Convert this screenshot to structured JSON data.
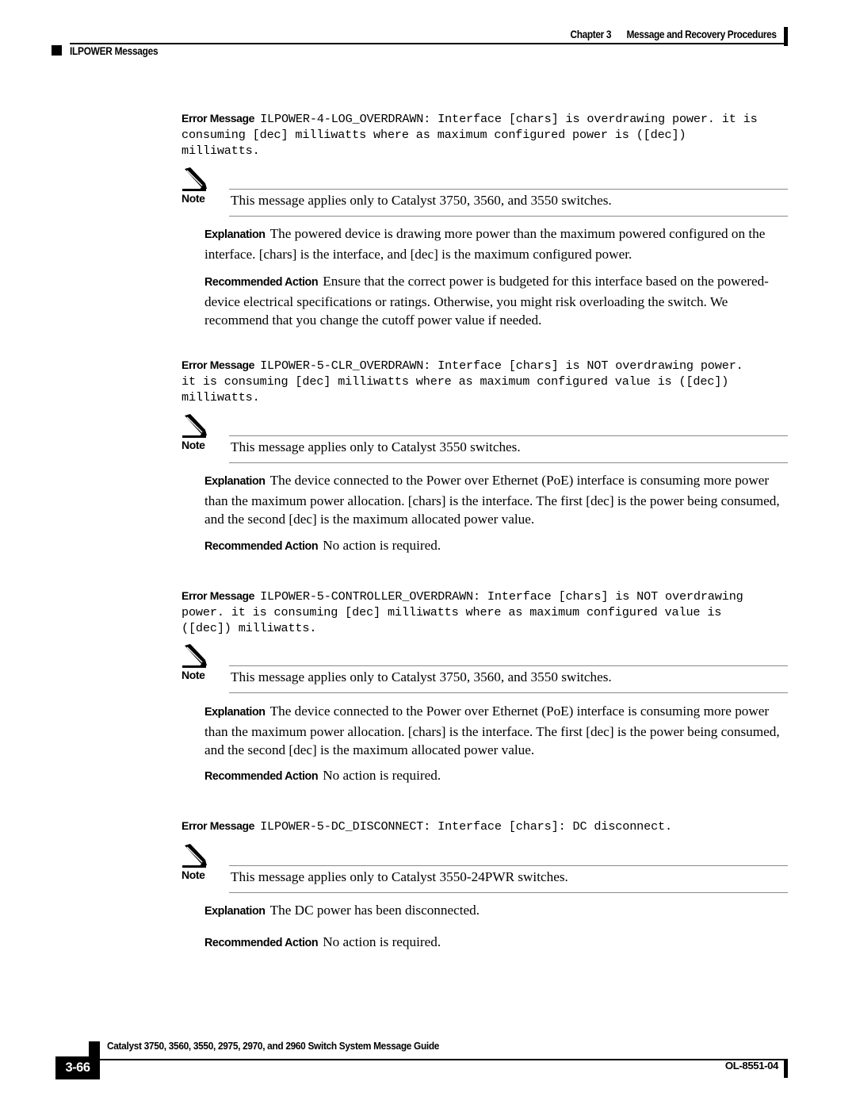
{
  "header": {
    "chapter_number": "Chapter 3",
    "chapter_title": "Message and Recovery Procedures",
    "section_title": "ILPOWER Messages"
  },
  "blocks": [
    {
      "error_message_label": "Error Message",
      "error_message_lines": [
        "ILPOWER-4-LOG_OVERDRAWN: Interface [chars] is overdrawing power. it is",
        "consuming [dec] milliwatts where as maximum configured power is ([dec])",
        "milliwatts."
      ],
      "note_label": "Note",
      "note_text": "This message applies only to Catalyst 3750, 3560, and 3550 switches.",
      "explanation_label": "Explanation",
      "explanation_text": "The powered device is drawing more power than the maximum powered configured on the interface. [chars] is the interface, and [dec] is the maximum configured power.",
      "action_label": "Recommended Action",
      "action_text": "Ensure that the correct power is budgeted for this interface based on the powered-device electrical specifications or ratings. Otherwise, you might risk overloading the switch. We recommend that you change the cutoff power value if needed."
    },
    {
      "error_message_label": "Error Message",
      "error_message_lines": [
        "ILPOWER-5-CLR_OVERDRAWN: Interface [chars] is NOT overdrawing power.",
        "it is consuming [dec] milliwatts where as maximum configured value is ([dec])",
        "milliwatts."
      ],
      "note_label": "Note",
      "note_text": "This message applies only to Catalyst 3550 switches.",
      "explanation_label": "Explanation",
      "explanation_text": "The device connected to the Power over Ethernet (PoE) interface is consuming more power than the maximum power allocation. [chars] is the interface. The first [dec] is the power being consumed, and the second [dec] is the maximum allocated power value.",
      "action_label": "Recommended Action",
      "action_text": "No action is required."
    },
    {
      "error_message_label": "Error Message",
      "error_message_lines": [
        "ILPOWER-5-CONTROLLER_OVERDRAWN: Interface [chars] is NOT overdrawing",
        "power. it is consuming [dec] milliwatts where as maximum configured value is",
        "([dec]) milliwatts."
      ],
      "note_label": "Note",
      "note_text": "This message applies only to Catalyst 3750, 3560, and 3550 switches.",
      "explanation_label": "Explanation",
      "explanation_text": "The device connected to the Power over Ethernet (PoE) interface is consuming more power than the maximum power allocation. [chars] is the interface. The first [dec] is the power being consumed, and the second [dec] is the maximum allocated power value.",
      "action_label": "Recommended Action",
      "action_text": "No action is required."
    },
    {
      "error_message_label": "Error Message",
      "error_message_lines": [
        "ILPOWER-5-DC_DISCONNECT: Interface [chars]: DC disconnect."
      ],
      "note_label": "Note",
      "note_text": "This message applies only to Catalyst 3550-24PWR switches.",
      "explanation_label": "Explanation",
      "explanation_text": "The DC power has been disconnected.",
      "action_label": "Recommended Action",
      "action_text": "No action is required."
    }
  ],
  "footer": {
    "page_number": "3-66",
    "guide_title": "Catalyst 3750, 3560, 3550, 2975, 2970, and 2960 Switch System Message Guide",
    "document_id": "OL-8551-04"
  },
  "icons": {
    "note_icon": "pencil-icon"
  },
  "colors": {
    "text": "#000000",
    "rule": "#8a8a8a",
    "page_background": "#ffffff"
  }
}
